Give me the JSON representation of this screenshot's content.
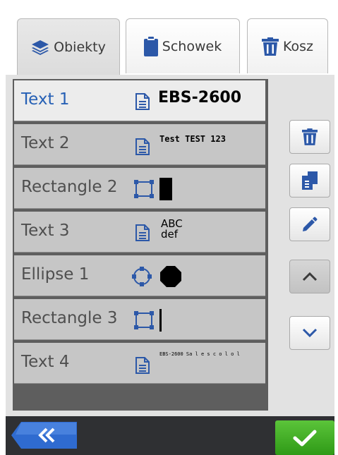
{
  "tabs": [
    {
      "label": "Obiekty",
      "icon": "layers-icon",
      "active": true
    },
    {
      "label": "Schowek",
      "icon": "clipboard-icon",
      "active": false
    },
    {
      "label": "Kosz",
      "icon": "trash-icon",
      "active": false
    }
  ],
  "objects": [
    {
      "label": "Text 1",
      "type": "text",
      "preview": "EBS-2600",
      "selected": true
    },
    {
      "label": "Text 2",
      "type": "text",
      "preview": "Test TEST 123",
      "selected": false
    },
    {
      "label": "Rectangle 2",
      "type": "rectangle",
      "preview": "",
      "selected": false
    },
    {
      "label": "Text 3",
      "type": "text",
      "preview_lines": [
        "ABC",
        "def"
      ],
      "selected": false
    },
    {
      "label": "Ellipse 1",
      "type": "ellipse",
      "preview": "",
      "selected": false
    },
    {
      "label": "Rectangle 3",
      "type": "rectangle",
      "preview": "",
      "selected": false
    },
    {
      "label": "Text 4",
      "type": "text",
      "preview": "EBS-2600 Sa l e s c o l o l",
      "selected": false
    }
  ],
  "side_buttons": [
    {
      "name": "delete-button",
      "icon": "trash-icon"
    },
    {
      "name": "copy-button",
      "icon": "copy-icon"
    },
    {
      "name": "edit-button",
      "icon": "pencil-icon"
    },
    {
      "name": "move-up-button",
      "icon": "chevron-up-icon"
    },
    {
      "name": "move-down-button",
      "icon": "chevron-down-icon"
    }
  ],
  "bottom": {
    "back_icon": "double-chevron-left-icon",
    "confirm_icon": "check-icon"
  },
  "colors": {
    "accent_blue": "#2c58a8",
    "selected_text": "#2660b5",
    "confirm_green": "#3fae24"
  }
}
